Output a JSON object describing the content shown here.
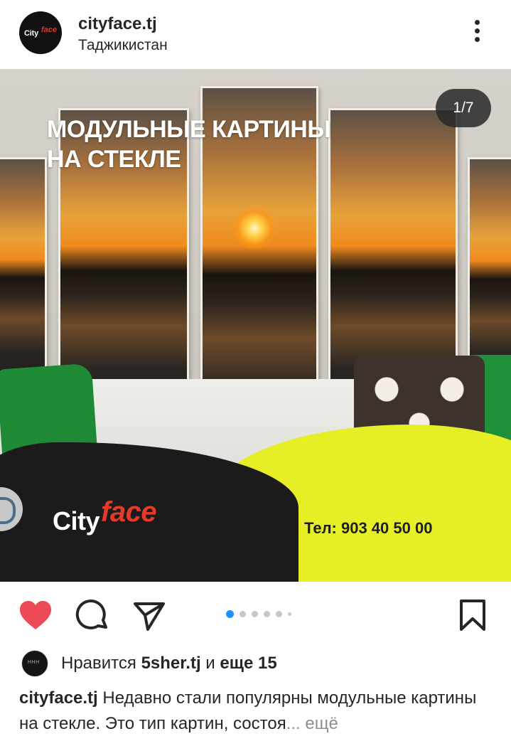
{
  "header": {
    "username": "cityface.tj",
    "location": "Таджикистан",
    "avatar_text_city": "City",
    "avatar_text_face": "face",
    "more_icon": "more-vertical-icon"
  },
  "post": {
    "headline_line1": "МОДУЛЬНЫЕ КАРТИНЫ",
    "headline_line2": "НА СТЕКЛЕ",
    "counter": "1/7",
    "brand_city": "City",
    "brand_face": "face",
    "phone": "Тел: 903 40 50 00"
  },
  "actions": {
    "like_icon": "heart-filled-icon",
    "comment_icon": "comment-icon",
    "share_icon": "send-icon",
    "save_icon": "bookmark-icon",
    "liked_color": "#ed4956",
    "dot_active_color": "#1e90ff"
  },
  "likes": {
    "prefix": "Нравится ",
    "user": "5sher.tj",
    "mid": " и ",
    "others": "еще 15"
  },
  "caption": {
    "username": "cityface.tj",
    "text": " Недавно стали популярны модульные картины на стекле. Это тип картин, состоя",
    "ellipsis": "...",
    "more": " ещё"
  }
}
